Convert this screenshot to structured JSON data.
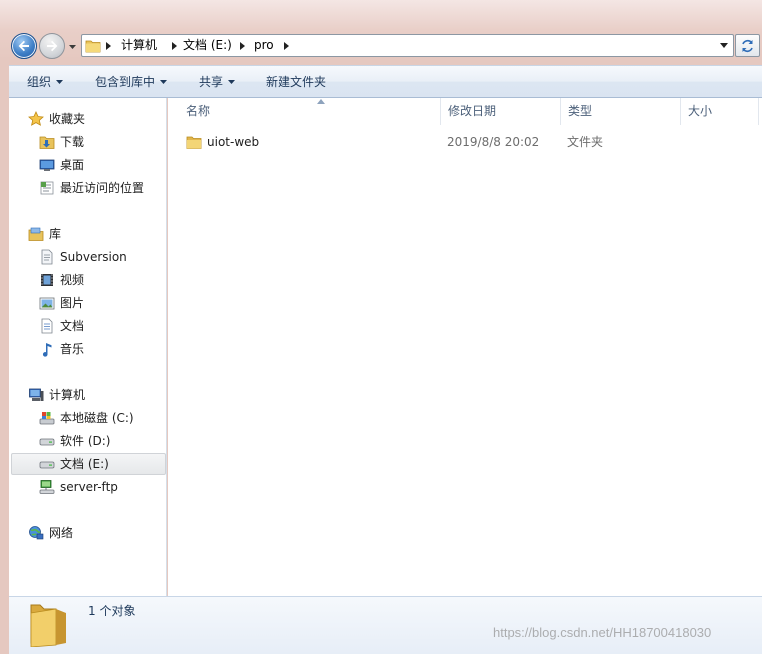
{
  "address": {
    "crumbs": [
      "计算机",
      "文档 (E:)",
      "pro"
    ]
  },
  "toolbar": {
    "organize": "组织",
    "include_in_library": "包含到库中",
    "share": "共享",
    "new_folder": "新建文件夹"
  },
  "navpane": {
    "favorites": {
      "header": "收藏夹",
      "items": [
        "下载",
        "桌面",
        "最近访问的位置"
      ]
    },
    "libraries": {
      "header": "库",
      "items": [
        "Subversion",
        "视频",
        "图片",
        "文档",
        "音乐"
      ]
    },
    "computer": {
      "header": "计算机",
      "items": [
        "本地磁盘 (C:)",
        "软件 (D:)",
        "文档 (E:)",
        "server-ftp"
      ],
      "selected": "文档 (E:)"
    },
    "network": {
      "header": "网络"
    }
  },
  "columns": {
    "name": "名称",
    "modified": "修改日期",
    "type": "类型",
    "size": "大小"
  },
  "files": [
    {
      "name": "uiot-web",
      "modified": "2019/8/8 20:02",
      "type": "文件夹",
      "size": ""
    }
  ],
  "status": {
    "count": "1 个对象"
  },
  "watermark": "https://blog.csdn.net/HH18700418030",
  "colors": {
    "accent": "#3f7fc7",
    "folder": "#e8c35c",
    "header_text": "#4c607a",
    "toolbar_text": "#1e395b"
  }
}
